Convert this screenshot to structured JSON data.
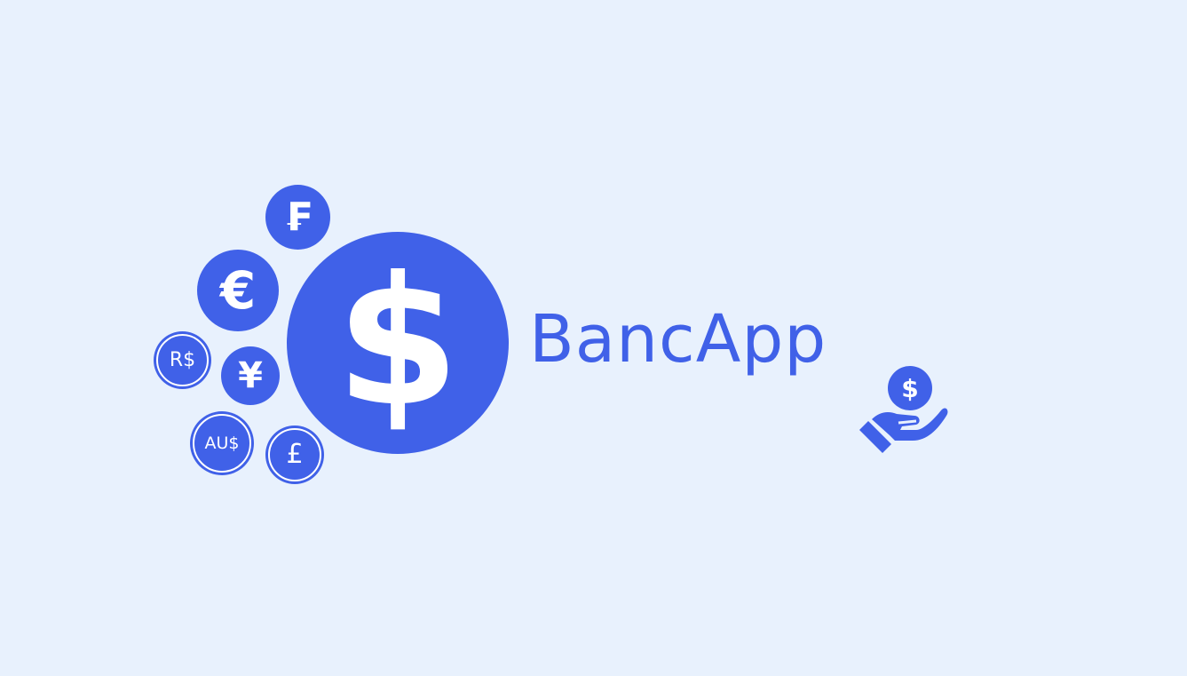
{
  "background_color": "#e8f1fd",
  "accent_color": "#4061e8",
  "brand": {
    "name": "BancApp"
  },
  "coins": {
    "franc": "₣",
    "euro": "€",
    "real": "R$",
    "yen": "¥",
    "aud": "AU$",
    "pound": "£",
    "dollar": "$"
  },
  "icons": {
    "hand": "hand-holding-coin-icon",
    "hand_coin": "$"
  }
}
